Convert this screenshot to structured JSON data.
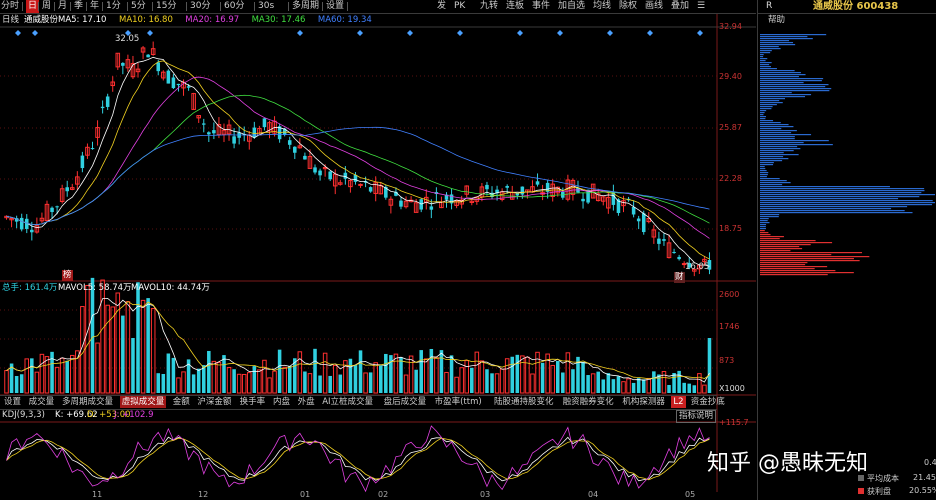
{
  "toolbar": {
    "periods": [
      "分时",
      "日",
      "周",
      "月",
      "季",
      "年",
      "1分",
      "5分",
      "15分",
      "30分",
      "60分",
      "30s",
      "多周期",
      "设置"
    ],
    "active_period": "日",
    "right_tools": [
      "发",
      "PK",
      "九转",
      "连板",
      "事件",
      "加自选",
      "均线",
      "除权",
      "画线",
      "叠加",
      "☰"
    ]
  },
  "chart": {
    "period_label": "日线",
    "stock_name": "通威股份",
    "ma": [
      {
        "label": "MA5: 17.10",
        "color": "#ffffff"
      },
      {
        "label": "MA10: 16.80",
        "color": "#f0d020"
      },
      {
        "label": "MA20: 16.97",
        "color": "#e040e0"
      },
      {
        "label": "MA30: 17.46",
        "color": "#40e040"
      },
      {
        "label": "MA60: 19.34",
        "color": "#4080ff"
      }
    ],
    "price_axis": [
      "32.94",
      "29.40",
      "25.87",
      "22.28",
      "18.75"
    ],
    "high_label": "32.05",
    "low_label": "16.05",
    "marker_top": "榜",
    "marker_bottom": "财"
  },
  "volume": {
    "label_total": "总手: 161.4万",
    "label_mavol5": "MAVOL5: 58.74万",
    "label_mavol10": "MAVOL10: 44.74万",
    "axis": [
      "2600",
      "1746",
      "873",
      "X1000"
    ]
  },
  "tabs": [
    "设置",
    "成交量",
    "多周期成交量",
    "虚拟成交量",
    "金额",
    "沪深金额",
    "换手率",
    "内盘",
    "外盘",
    "AI立桩成交量",
    "盘后成交量",
    "市盈率(ttm)",
    "陆股通持股变化",
    "融资融券变化",
    "机构探测器",
    "L2",
    "资金抄底"
  ],
  "active_tab": "虚拟成交量",
  "kdj": {
    "label_main": "KDJ(9,3,3)",
    "label_k": "K: +69.62",
    "label_d": "D: +53.00",
    "label_j": "J: +102.9",
    "axis_top": "+115.7",
    "help": "指标说明",
    "dates": [
      "11",
      "12",
      "01",
      "02",
      "03",
      "04",
      "05"
    ]
  },
  "right_panel": {
    "code": "通威股份 600438",
    "r_label": "R",
    "help_button": "帮助",
    "avg_cost_label": "平均成本",
    "avg_cost_value": "21.45",
    "profit_label": "获利盘",
    "profit_value": "20.55%",
    "pct_partial": "0.45%"
  },
  "watermark": "知乎 @愚昧无知",
  "colors": {
    "up": "#ff3030",
    "down": "#30d0e0",
    "axis": "#cc3333",
    "grid": "#7a1a1a",
    "bg": "#000000"
  }
}
